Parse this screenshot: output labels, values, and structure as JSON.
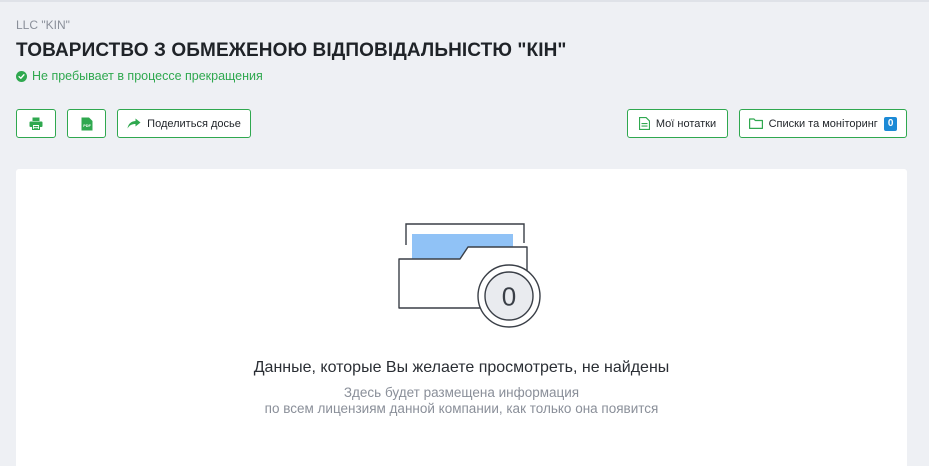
{
  "company": {
    "short_name": "LLC \"KIN\"",
    "full_name": "ТОВАРИСТВО З ОБМЕЖЕНОЮ ВІДПОВІДАЛЬНІСТЮ \"КІН\"",
    "status": "Не пребывает в процессе прекращения",
    "status_color": "#2fa84f"
  },
  "toolbar": {
    "print_icon": "printer-icon",
    "pdf_icon": "pdf-icon",
    "pdf_icon_text": "PDF",
    "share_label": "Поделиться досье",
    "notes_label": "Мої нотатки",
    "lists_label": "Списки та моніторинг",
    "lists_count": "0",
    "accent_color": "#2fa84f",
    "badge_color": "#1c8ad6"
  },
  "empty_state": {
    "illustration_icon": "empty-folder-icon",
    "counter": "0",
    "title": "Данные, которые Вы желаете просмотреть, не найдены",
    "line1": "Здесь будет размещена информация",
    "line2": "по всем лицензиям данной компании, как только она появится"
  }
}
